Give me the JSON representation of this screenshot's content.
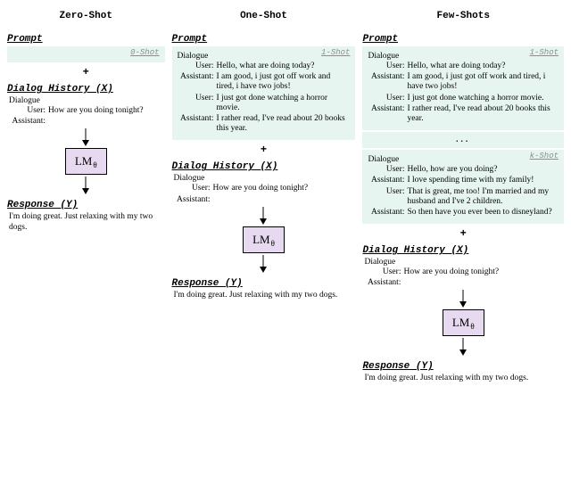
{
  "columns": {
    "zero": {
      "title": "Zero-Shot"
    },
    "one": {
      "title": "One-Shot"
    },
    "few": {
      "title": "Few-Shots"
    }
  },
  "labels": {
    "prompt": "Prompt",
    "dialog_history": "Dialog History (X)",
    "response": "Response (Y)",
    "plus": "+",
    "dialogue": "Dialogue",
    "ellipsis": "...",
    "lm": "LM",
    "lm_sub": "θ"
  },
  "shot_tags": {
    "zero": "0-Shot",
    "one": "1-Shot",
    "few_first": "1-Shot",
    "few_k": "k-Shot"
  },
  "roles": {
    "user": "User:",
    "assistant": "Assistant:"
  },
  "shots": {
    "shot1": {
      "t1": "Hello, what are doing today?",
      "t2": "I am good, i just got off work and tired, i have two jobs!",
      "t3": "I just got done watching a horror movie.",
      "t4": "I rather read, I've read about 20 books this year."
    },
    "shotk": {
      "t1": "Hello, how are you doing?",
      "t2": "I love spending time with my family!",
      "t3": "That is great, me too! I'm married and my husband and I've 2 children.",
      "t4": "So then have you ever been to disneyland?"
    }
  },
  "history": {
    "user_turn": "How are you doing tonight?",
    "assistant_pending": ""
  },
  "response": "I'm doing great. Just relaxing with my two dogs.",
  "colors": {
    "prompt_bg": "#e6f5ef",
    "lm_bg": "#e7d9ef"
  }
}
